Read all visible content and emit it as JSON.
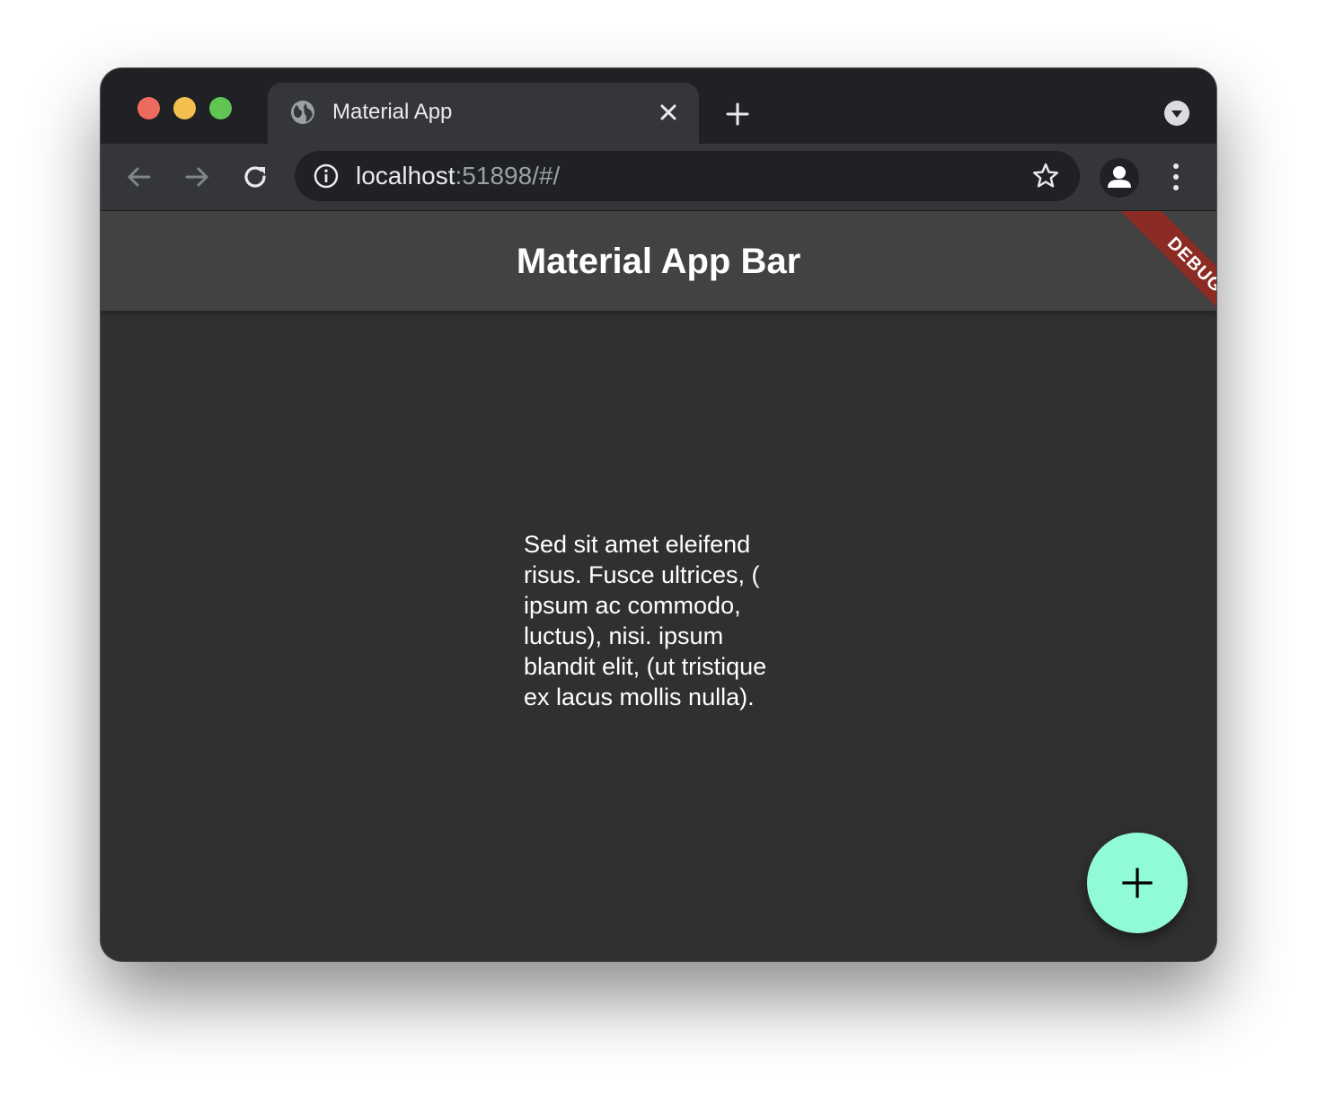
{
  "browser": {
    "tab": {
      "title": "Material App",
      "favicon": "globe-icon"
    },
    "address": {
      "host": "localhost",
      "rest": ":51898/#/"
    },
    "icons": {
      "back": "arrow-left-icon",
      "forward": "arrow-right-icon",
      "reload": "reload-icon",
      "info": "info-icon",
      "bookmark": "star-icon",
      "profile": "person-icon",
      "menu": "kebab-menu-icon"
    }
  },
  "app": {
    "appbar_title": "Material App Bar",
    "debug_banner": "DEBUG",
    "body_text": "Sed sit amet eleifend risus. Fusce ultrices, ( ipsum ac commodo, luctus), nisi. ipsum blandit elit, (ut tristique ex lacus mollis nulla).",
    "fab_icon": "add-icon"
  },
  "colors": {
    "tabstrip": "#202124",
    "toolbar": "#35363a",
    "appbar": "#424242",
    "background": "#303030",
    "fab": "#91fbd9",
    "debug_banner": "#8b2b23"
  }
}
